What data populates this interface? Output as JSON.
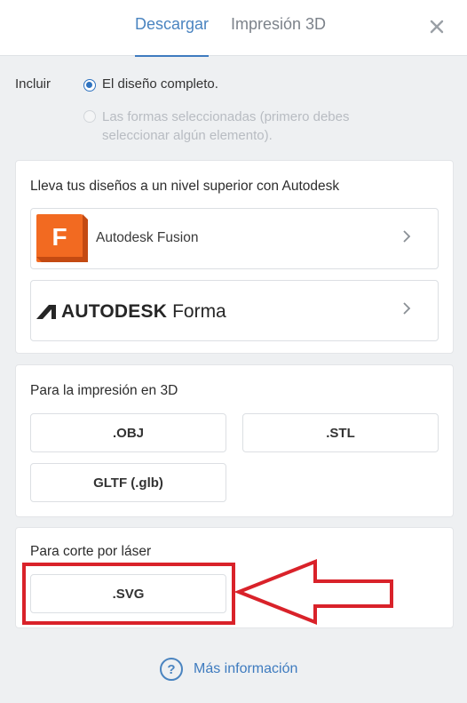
{
  "tabs": [
    {
      "label": "Descargar",
      "active": true
    },
    {
      "label": "Impresión 3D",
      "active": false
    }
  ],
  "close_icon": "close-icon",
  "include": {
    "label": "Incluir",
    "options": [
      {
        "label": "El diseño completo.",
        "selected": true,
        "enabled": true
      },
      {
        "label": "Las formas seleccionadas (primero debes seleccionar algún elemento).",
        "selected": false,
        "enabled": false
      }
    ]
  },
  "autodesk_card": {
    "title": "Lleva tus diseños a un nivel superior con Autodesk",
    "items": [
      {
        "label": "Autodesk Fusion",
        "logo_letter": "F",
        "icon": "chevron-right-icon"
      },
      {
        "logo_text_bold": "AUTODESK",
        "logo_text": "Forma",
        "icon": "chevron-right-icon"
      }
    ]
  },
  "print3d_card": {
    "title": "Para la impresión en 3D",
    "formats": [
      ".OBJ",
      ".STL",
      "GLTF (.glb)"
    ]
  },
  "laser_card": {
    "title": "Para corte por láser",
    "formats": [
      ".SVG"
    ]
  },
  "more_info": {
    "label": "Más información",
    "icon": "question-circle-icon"
  },
  "colors": {
    "accent": "#3e7bbf",
    "highlight": "#d9222a",
    "fusion_orange": "#f26a21"
  }
}
